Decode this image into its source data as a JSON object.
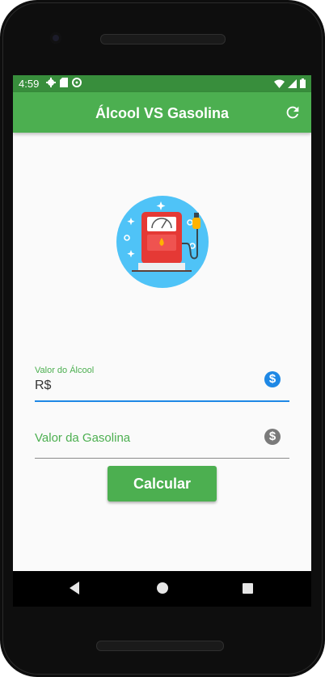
{
  "status_bar": {
    "time": "4:59",
    "left_icons": [
      "gear-icon",
      "sd-card-icon",
      "sync-icon"
    ],
    "right_icons": [
      "wifi-icon",
      "signal-icon",
      "battery-icon"
    ]
  },
  "app_bar": {
    "title": "Álcool VS Gasolina",
    "action_icon": "refresh-icon"
  },
  "logo": {
    "icon": "fuel-pump-icon"
  },
  "form": {
    "alcool_field": {
      "label": "Valor do Álcool",
      "value": "R$",
      "icon": "dollar-icon",
      "focused": true
    },
    "gasolina_field": {
      "label": "Valor da Gasolina",
      "icon": "dollar-icon",
      "focused": false
    },
    "calculate_button": "Calcular"
  },
  "nav_bar": {
    "buttons": [
      "back",
      "home",
      "recents"
    ]
  },
  "colors": {
    "primary": "#4caf50",
    "primary_dark": "#388e3c",
    "accent": "#1e88e5"
  }
}
